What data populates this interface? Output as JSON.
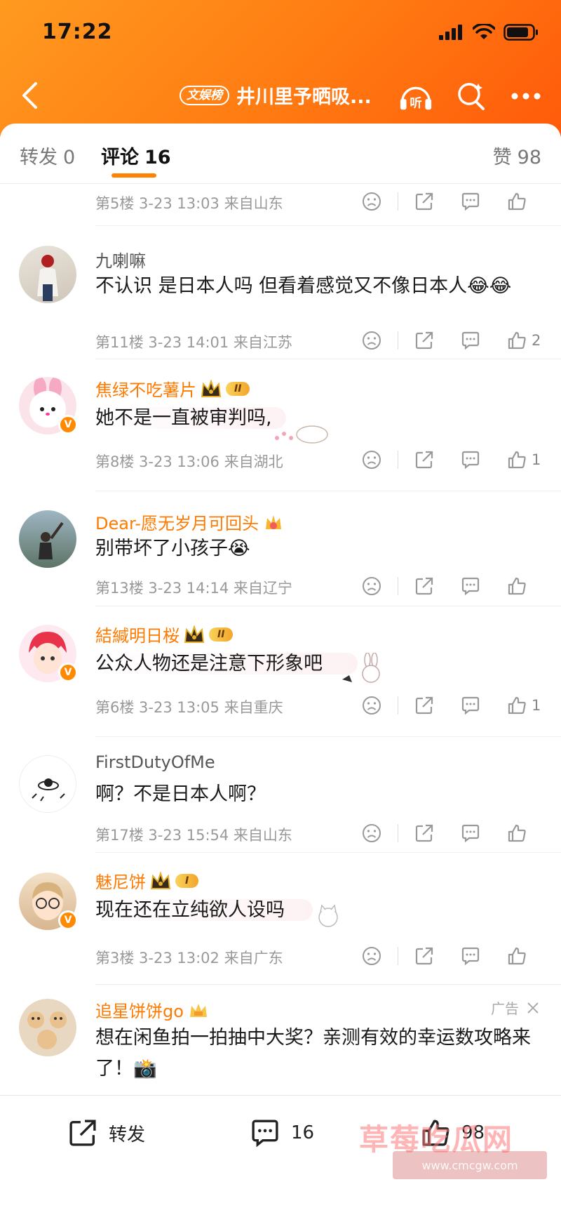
{
  "status": {
    "time": "17:22"
  },
  "nav": {
    "badge": "文娱榜",
    "title": "井川里予晒吸...",
    "listen_label": "听"
  },
  "tabs": {
    "repost_label": "转发",
    "repost_count": "0",
    "comment_label": "评论",
    "comment_count": "16",
    "like_label": "赞",
    "like_count": "98"
  },
  "comments": [
    {
      "name": "",
      "text": "",
      "meta": "第5楼 3-23 13:03 来自山东",
      "likes": ""
    },
    {
      "name": "九喇嘛",
      "text": "不认识 是日本人吗 但看着感觉又不像日本人😂😂",
      "meta": "第11楼 3-23 14:01 来自江苏",
      "likes": "2"
    },
    {
      "name": "焦绿不吃薯片",
      "vip_level": "II",
      "text": "她不是一直被审判吗,",
      "meta": "第8楼 3-23 13:06 来自湖北",
      "likes": "1"
    },
    {
      "name": "Dear-愿无岁月可回头",
      "text": "别带坏了小孩子😭",
      "meta": "第13楼 3-23 14:14 来自辽宁",
      "likes": ""
    },
    {
      "name": "結緘明日桜",
      "vip_level": "II",
      "text": "公众人物还是注意下形象吧",
      "meta": "第6楼 3-23 13:05 来自重庆",
      "likes": "1"
    },
    {
      "name": "FirstDutyOfMe",
      "text": "啊？不是日本人啊？",
      "meta": "第17楼 3-23 15:54 来自山东",
      "likes": ""
    },
    {
      "name": "魅尼饼",
      "vip_level": "I",
      "text": "现在还在立纯欲人设吗",
      "meta": "第3楼 3-23 13:02 来自广东",
      "likes": ""
    },
    {
      "name": "追星饼饼go",
      "ad_label": "广告",
      "text": "想在闲鱼拍一拍抽中大奖？亲测有效的幸运数攻略来了！📸"
    }
  ],
  "bottom": {
    "repost_label": "转发",
    "comment_count": "16",
    "like_count": "98"
  },
  "watermark": {
    "main": "草莓吃瓜网",
    "sub": "www.cmcgw.com"
  },
  "colors": {
    "accent": "#ff8200",
    "vip_name": "#ff7a00"
  }
}
